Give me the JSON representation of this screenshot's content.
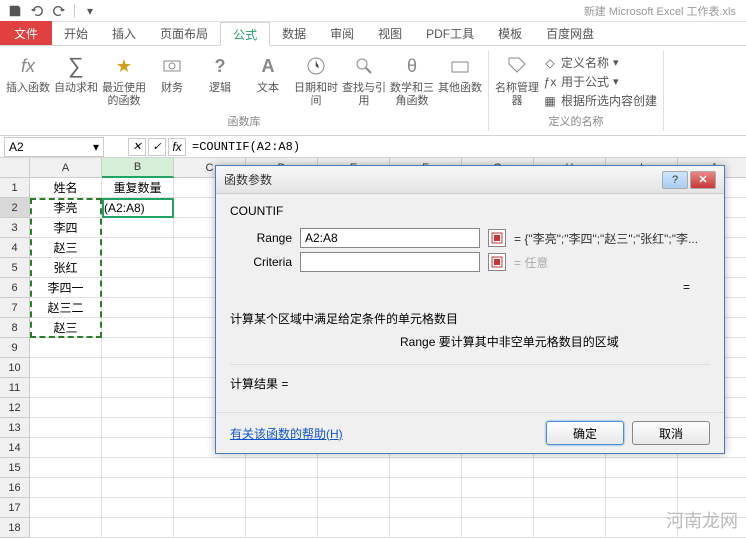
{
  "window": {
    "title": "新建 Microsoft Excel 工作表.xls"
  },
  "tabs": {
    "file": "文件",
    "items": [
      "开始",
      "插入",
      "页面布局",
      "公式",
      "数据",
      "审阅",
      "视图",
      "PDF工具",
      "模板",
      "百度网盘"
    ],
    "activeIndex": 3
  },
  "ribbon": {
    "insert_fn": "插入函数",
    "autosum": "自动求和",
    "recent": "最近使用的函数",
    "financial": "财务",
    "logical": "逻辑",
    "text": "文本",
    "datetime": "日期和时间",
    "lookup": "查找与引用",
    "math": "数学和三角函数",
    "more": "其他函数",
    "group_lib": "函数库",
    "name_mgr": "名称管理器",
    "define_name": "定义名称",
    "use_in_formula": "用于公式",
    "create_from_sel": "根据所选内容创建",
    "group_names": "定义的名称"
  },
  "namebox": "A2",
  "formula": "=COUNTIF(A2:A8)",
  "columns": [
    "A",
    "B",
    "C",
    "D",
    "E",
    "F",
    "G",
    "H",
    "I",
    "J"
  ],
  "rows": [
    "1",
    "2",
    "3",
    "4",
    "5",
    "6",
    "7",
    "8",
    "9",
    "10",
    "11",
    "12",
    "13",
    "14",
    "15",
    "16",
    "17",
    "18"
  ],
  "data": {
    "A1": "姓名",
    "B1": "重复数量",
    "A2": "李亮",
    "B2": "(A2:A8)",
    "A3": "李四",
    "A4": "赵三",
    "A5": "张红",
    "A6": "李四一",
    "A7": "赵三二",
    "A8": "赵三"
  },
  "dialog": {
    "title": "函数参数",
    "fn": "COUNTIF",
    "range_label": "Range",
    "range_value": "A2:A8",
    "range_result": "= {\"李亮\";\"李四\";\"赵三\";\"张红\";\"李...",
    "criteria_label": "Criteria",
    "criteria_value": "",
    "criteria_result": "= 任意",
    "eq": "=",
    "desc": "计算某个区域中满足给定条件的单元格数目",
    "arg_desc": "Range  要计算其中非空单元格数目的区域",
    "result_label": "计算结果 =",
    "help": "有关该函数的帮助(H)",
    "ok": "确定",
    "cancel": "取消"
  },
  "watermark": "河南龙网"
}
